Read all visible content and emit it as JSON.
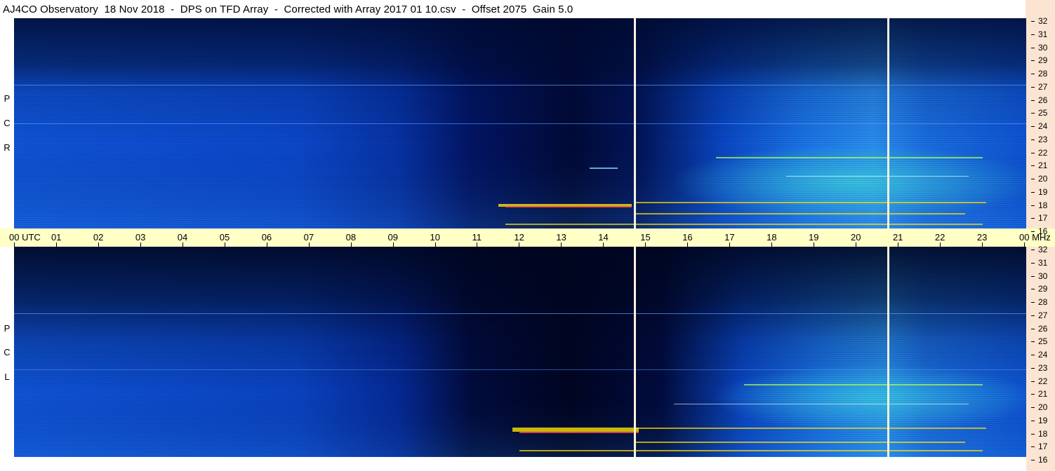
{
  "header": {
    "title": "AJ4CO Observatory  18 Nov 2018  -  DPS on TFD Array  -  Corrected with Array 2017 01 10.csv  -  Offset 2075  Gain 5.0"
  },
  "panels": {
    "top": {
      "polarization": [
        "R",
        "C",
        "P"
      ]
    },
    "bottom": {
      "polarization": [
        "L",
        "C",
        "P"
      ]
    }
  },
  "time_axis": {
    "labels": [
      "00 UTC",
      "01",
      "02",
      "03",
      "04",
      "05",
      "06",
      "07",
      "08",
      "09",
      "10",
      "11",
      "12",
      "13",
      "14",
      "15",
      "16",
      "17",
      "18",
      "19",
      "20",
      "21",
      "22",
      "23",
      "00 MHz"
    ]
  },
  "freq_axis": {
    "labels": [
      "32",
      "31",
      "30",
      "29",
      "28",
      "27",
      "26",
      "25",
      "24",
      "23",
      "22",
      "21",
      "20",
      "19",
      "18",
      "17",
      "16"
    ]
  },
  "colors": {
    "background_blue": "#0040c8",
    "deep_night": "#000820",
    "axis_yellow": "#ffffc6",
    "freq_strip": "#fce4d2",
    "hot_band": "#ffe000"
  }
}
